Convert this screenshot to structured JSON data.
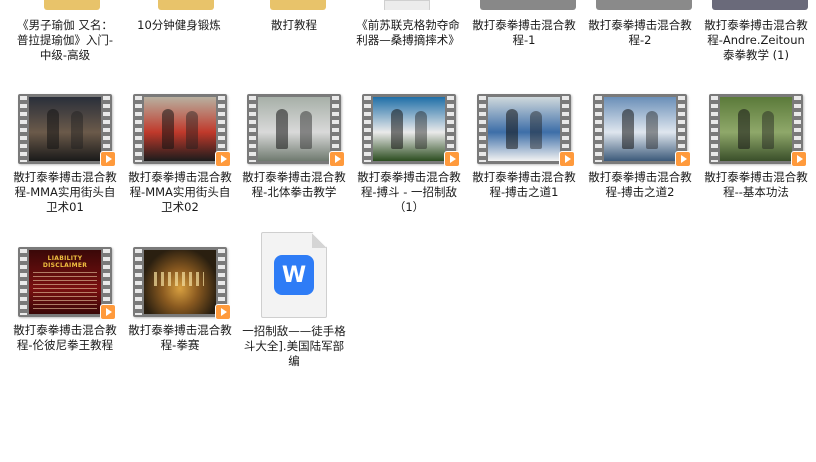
{
  "row0": [
    {
      "label": "《男子瑜伽 又名：普拉提瑜伽》入门-中级-高级",
      "icon": "folder-icon"
    },
    {
      "label": "10分钟健身锻炼",
      "icon": "folder-icon"
    },
    {
      "label": "散打教程",
      "icon": "folder-icon"
    },
    {
      "label": "《前苏联克格勃夺命利器—桑搏摘摔术》",
      "icon": "document-icon"
    },
    {
      "label": "散打泰拳搏击混合教程-1",
      "icon": "video-icon"
    },
    {
      "label": "散打泰拳搏击混合教程-2",
      "icon": "video-icon"
    },
    {
      "label": "散打泰拳搏击混合教程-Andre.Zeitoun泰拳教学 (1)",
      "icon": "video-icon"
    }
  ],
  "row1": [
    {
      "label": "散打泰拳搏击混合教程-MMA实用街头自卫术01",
      "icon": "video-icon",
      "colors": [
        "#2a2f3a",
        "#6b5a4a",
        "#1a1a1a"
      ]
    },
    {
      "label": "散打泰拳搏击混合教程-MMA实用街头自卫术02",
      "icon": "video-icon",
      "colors": [
        "#b8b0a0",
        "#c0392b",
        "#1c1c1c"
      ]
    },
    {
      "label": "散打泰拳搏击混合教程-北体拳击教学",
      "icon": "video-icon",
      "colors": [
        "#a7b0a8",
        "#d9d9d9",
        "#6f7a6f"
      ]
    },
    {
      "label": "散打泰拳搏击混合教程-搏斗 - 一招制敌（1）",
      "icon": "video-icon",
      "colors": [
        "#1f6fa8",
        "#eaeaea",
        "#2b4d1f"
      ]
    },
    {
      "label": "散打泰拳搏击混合教程-搏击之道1",
      "icon": "video-icon",
      "colors": [
        "#cfd8dc",
        "#3d6ea8",
        "#f2f2f2"
      ]
    },
    {
      "label": "散打泰拳搏击混合教程-搏击之道2",
      "icon": "video-icon",
      "colors": [
        "#6a8fb8",
        "#dfe6ee",
        "#3c5a7a"
      ]
    },
    {
      "label": "散打泰拳搏击混合教程--基本功法",
      "icon": "video-icon",
      "colors": [
        "#5b7a3a",
        "#8fa86a",
        "#3a4f2a"
      ]
    }
  ],
  "row2": [
    {
      "label": "散打泰拳搏击混合教程-伦彼尼拳王教程",
      "icon": "video-icon",
      "overlay": "LIABILITY DISCLAIMER",
      "colors": [
        "#3a0808",
        "#b01818",
        "#f0c040"
      ]
    },
    {
      "label": "散打泰拳搏击混合教程-拳赛",
      "icon": "video-icon",
      "colors": [
        "#2a1f10",
        "#8a5a20",
        "#d8a040"
      ]
    },
    {
      "label": "一招制敌——徒手格斗大全].美国陆军部编",
      "icon": "wps-document-icon",
      "wps_letter": "W"
    }
  ]
}
